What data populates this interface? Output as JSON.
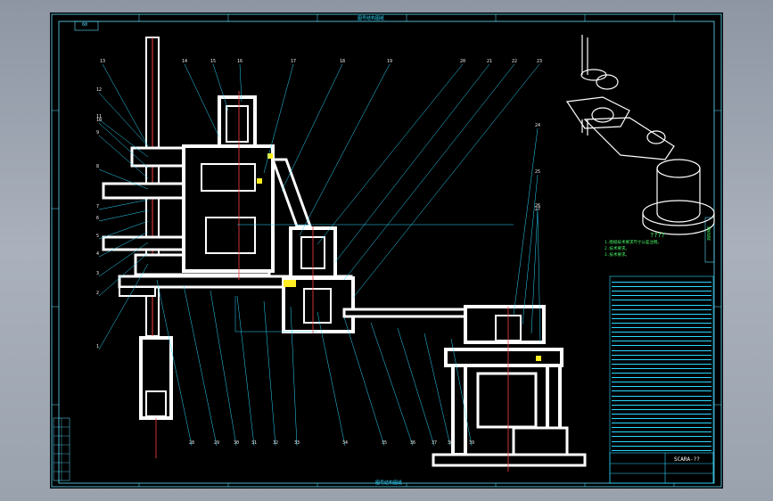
{
  "drawing": {
    "title_top": "图号结构图纸",
    "title_bottom": "图号结构图纸",
    "corner_box": "60",
    "question_marks": "????",
    "tech_req_lines": [
      "1.图纸技术要求尺寸公差注明。",
      "2.技术要求。",
      "3.技术要求。"
    ],
    "title_block_code": "SCARA-??",
    "right_strip_label": "图纸结构"
  },
  "callouts_top": [
    "13",
    "14",
    "15",
    "16",
    "17",
    "18",
    "19",
    "20",
    "21",
    "22",
    "23"
  ],
  "callouts_left": [
    "12",
    "11",
    "10",
    "9",
    "8",
    "7",
    "6",
    "5",
    "4",
    "3",
    "2",
    "1"
  ],
  "callouts_right": [
    "24",
    "25",
    "26",
    "27"
  ],
  "callouts_bottom": [
    "28",
    "29",
    "30",
    "31",
    "32",
    "33",
    "34",
    "35",
    "36",
    "37",
    "38",
    "39"
  ],
  "bom_rows": 38,
  "colors": {
    "sheet": "#000000",
    "frame": "#5ee0ff",
    "lines": "#2ad8ff",
    "part": "#ffffff",
    "accent": "#ff4040",
    "highlight": "#ffee22",
    "bom_text": "#4dff6a"
  }
}
